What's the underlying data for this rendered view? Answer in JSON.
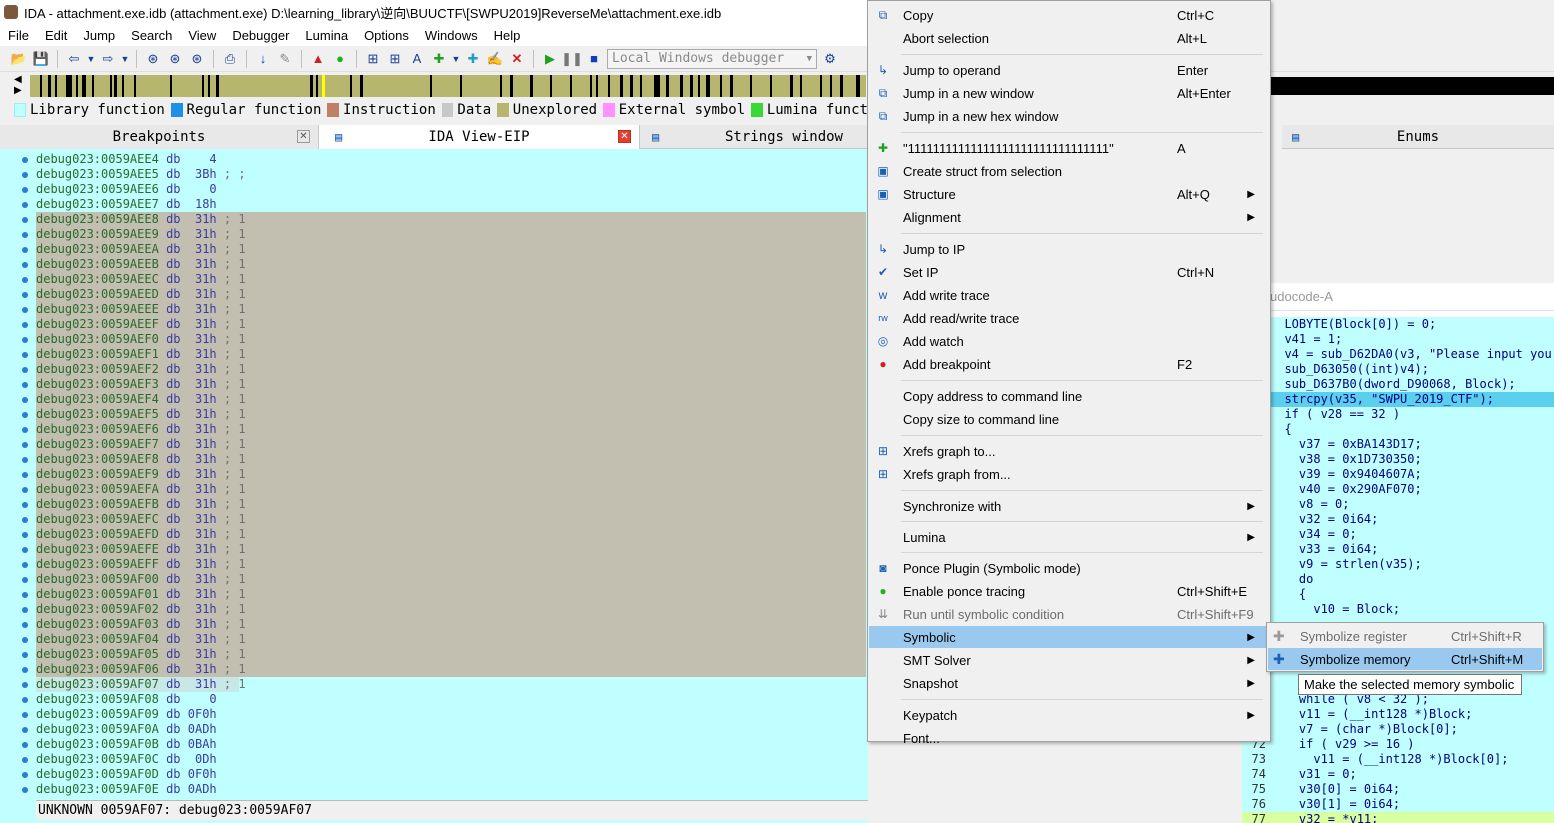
{
  "window": {
    "title": "IDA - attachment.exe.idb (attachment.exe) D:\\learning_library\\逆向\\BUUCTF\\[SWPU2019]ReverseMe\\attachment.exe.idb"
  },
  "menu": [
    "File",
    "Edit",
    "Jump",
    "Search",
    "View",
    "Debugger",
    "Lumina",
    "Options",
    "Windows",
    "Help"
  ],
  "toolbar": {
    "debugger": "Local Windows debugger"
  },
  "legend": [
    {
      "label": "Library function",
      "color": "#c0ffff"
    },
    {
      "label": "Regular function",
      "color": "#1e90e8"
    },
    {
      "label": "Instruction",
      "color": "#c08068"
    },
    {
      "label": "Data",
      "color": "#c8c8c8"
    },
    {
      "label": "Unexplored",
      "color": "#b6b66e"
    },
    {
      "label": "External symbol",
      "color": "#ff90ff"
    },
    {
      "label": "Lumina funct",
      "color": "#38d838"
    }
  ],
  "tabs": {
    "breakpoints": "Breakpoints",
    "ida_view": "IDA View-EIP",
    "strings": "Strings window",
    "enums": "Enums"
  },
  "disasm": [
    {
      "addr": "debug023:0059AEE4",
      "op": "db",
      "val": "   4",
      "cm": ""
    },
    {
      "addr": "debug023:0059AEE5",
      "op": "db",
      "val": " 3Bh",
      "cm": " ; ;"
    },
    {
      "addr": "debug023:0059AEE6",
      "op": "db",
      "val": "   0",
      "cm": ""
    },
    {
      "addr": "debug023:0059AEE7",
      "op": "db",
      "val": " 18h",
      "cm": ""
    },
    {
      "addr": "debug023:0059AEE8",
      "op": "db",
      "val": " 31h",
      "cm": " ; 1",
      "sel": true
    },
    {
      "addr": "debug023:0059AEE9",
      "op": "db",
      "val": " 31h",
      "cm": " ; 1",
      "sel": true
    },
    {
      "addr": "debug023:0059AEEA",
      "op": "db",
      "val": " 31h",
      "cm": " ; 1",
      "sel": true
    },
    {
      "addr": "debug023:0059AEEB",
      "op": "db",
      "val": " 31h",
      "cm": " ; 1",
      "sel": true
    },
    {
      "addr": "debug023:0059AEEC",
      "op": "db",
      "val": " 31h",
      "cm": " ; 1",
      "sel": true
    },
    {
      "addr": "debug023:0059AEED",
      "op": "db",
      "val": " 31h",
      "cm": " ; 1",
      "sel": true
    },
    {
      "addr": "debug023:0059AEEE",
      "op": "db",
      "val": " 31h",
      "cm": " ; 1",
      "sel": true
    },
    {
      "addr": "debug023:0059AEEF",
      "op": "db",
      "val": " 31h",
      "cm": " ; 1",
      "sel": true
    },
    {
      "addr": "debug023:0059AEF0",
      "op": "db",
      "val": " 31h",
      "cm": " ; 1",
      "sel": true
    },
    {
      "addr": "debug023:0059AEF1",
      "op": "db",
      "val": " 31h",
      "cm": " ; 1",
      "sel": true
    },
    {
      "addr": "debug023:0059AEF2",
      "op": "db",
      "val": " 31h",
      "cm": " ; 1",
      "sel": true
    },
    {
      "addr": "debug023:0059AEF3",
      "op": "db",
      "val": " 31h",
      "cm": " ; 1",
      "sel": true
    },
    {
      "addr": "debug023:0059AEF4",
      "op": "db",
      "val": " 31h",
      "cm": " ; 1",
      "sel": true
    },
    {
      "addr": "debug023:0059AEF5",
      "op": "db",
      "val": " 31h",
      "cm": " ; 1",
      "sel": true
    },
    {
      "addr": "debug023:0059AEF6",
      "op": "db",
      "val": " 31h",
      "cm": " ; 1",
      "sel": true
    },
    {
      "addr": "debug023:0059AEF7",
      "op": "db",
      "val": " 31h",
      "cm": " ; 1",
      "sel": true
    },
    {
      "addr": "debug023:0059AEF8",
      "op": "db",
      "val": " 31h",
      "cm": " ; 1",
      "sel": true
    },
    {
      "addr": "debug023:0059AEF9",
      "op": "db",
      "val": " 31h",
      "cm": " ; 1",
      "sel": true
    },
    {
      "addr": "debug023:0059AEFA",
      "op": "db",
      "val": " 31h",
      "cm": " ; 1",
      "sel": true
    },
    {
      "addr": "debug023:0059AEFB",
      "op": "db",
      "val": " 31h",
      "cm": " ; 1",
      "sel": true
    },
    {
      "addr": "debug023:0059AEFC",
      "op": "db",
      "val": " 31h",
      "cm": " ; 1",
      "sel": true
    },
    {
      "addr": "debug023:0059AEFD",
      "op": "db",
      "val": " 31h",
      "cm": " ; 1",
      "sel": true
    },
    {
      "addr": "debug023:0059AEFE",
      "op": "db",
      "val": " 31h",
      "cm": " ; 1",
      "sel": true
    },
    {
      "addr": "debug023:0059AEFF",
      "op": "db",
      "val": " 31h",
      "cm": " ; 1",
      "sel": true
    },
    {
      "addr": "debug023:0059AF00",
      "op": "db",
      "val": " 31h",
      "cm": " ; 1",
      "sel": true
    },
    {
      "addr": "debug023:0059AF01",
      "op": "db",
      "val": " 31h",
      "cm": " ; 1",
      "sel": true
    },
    {
      "addr": "debug023:0059AF02",
      "op": "db",
      "val": " 31h",
      "cm": " ; 1",
      "sel": true
    },
    {
      "addr": "debug023:0059AF03",
      "op": "db",
      "val": " 31h",
      "cm": " ; 1",
      "sel": true
    },
    {
      "addr": "debug023:0059AF04",
      "op": "db",
      "val": " 31h",
      "cm": " ; 1",
      "sel": true
    },
    {
      "addr": "debug023:0059AF05",
      "op": "db",
      "val": " 31h",
      "cm": " ; 1",
      "sel": true
    },
    {
      "addr": "debug023:0059AF06",
      "op": "db",
      "val": " 31h",
      "cm": " ; 1",
      "sel": true
    },
    {
      "addr": "debug023:0059AF07",
      "op": "db",
      "val": " 31h",
      "cm": " ; 1",
      "sel": true
    },
    {
      "addr": "debug023:0059AF08",
      "op": "db",
      "val": "   0",
      "cm": ""
    },
    {
      "addr": "debug023:0059AF09",
      "op": "db",
      "val": "0F0h",
      "cm": ""
    },
    {
      "addr": "debug023:0059AF0A",
      "op": "db",
      "val": "0ADh",
      "cm": ""
    },
    {
      "addr": "debug023:0059AF0B",
      "op": "db",
      "val": "0BAh",
      "cm": ""
    },
    {
      "addr": "debug023:0059AF0C",
      "op": "db",
      "val": " 0Dh",
      "cm": ""
    },
    {
      "addr": "debug023:0059AF0D",
      "op": "db",
      "val": "0F0h",
      "cm": ""
    },
    {
      "addr": "debug023:0059AF0E",
      "op": "db",
      "val": "0ADh",
      "cm": ""
    }
  ],
  "status": "UNKNOWN 0059AF07: debug023:0059AF07",
  "pseudocode": {
    "title": "udocode-A",
    "lines": [
      {
        "n": "44",
        "t": "  LOBYTE(Block[0]) = 0;"
      },
      {
        "n": "45",
        "t": "  v41 = 1;"
      },
      {
        "n": "46",
        "t": "  v4 = sub_D62DA0(v3, \"Please input you"
      },
      {
        "n": "47",
        "t": "  sub_D63050((int)v4);"
      },
      {
        "n": "48",
        "t": "  sub_D637B0(dword_D90068, Block);"
      },
      {
        "n": "49",
        "t": "  strcpy(v35, \"SWPU_2019_CTF\");",
        "hl": 1
      },
      {
        "n": "50",
        "t": "  if ( v28 == 32 )"
      },
      {
        "n": "51",
        "t": "  {"
      },
      {
        "n": "52",
        "t": "    v37 = 0xBA143D17;"
      },
      {
        "n": "53",
        "t": "    v38 = 0x1D730350;"
      },
      {
        "n": "54",
        "t": "    v39 = 0x9404607A;"
      },
      {
        "n": "55",
        "t": "    v40 = 0x290AF070;"
      },
      {
        "n": "56",
        "t": "    v8 = 0;"
      },
      {
        "n": "57",
        "t": "    v32 = 0i64;"
      },
      {
        "n": "58",
        "t": "    v34 = 0;"
      },
      {
        "n": "59",
        "t": "    v33 = 0i64;"
      },
      {
        "n": "60",
        "t": "    v9 = strlen(v35);"
      },
      {
        "n": "61",
        "t": "    do"
      },
      {
        "n": "62",
        "t": "    {"
      },
      {
        "n": "63",
        "t": "      v10 = Block;"
      },
      {
        "n": "64",
        "t": ""
      },
      {
        "n": "65",
        "t": ""
      },
      {
        "n": "66",
        "t": ""
      },
      {
        "n": "67",
        "t": ""
      },
      {
        "n": "68",
        "t": ""
      },
      {
        "n": "69",
        "t": "    while ( v8 < 32 );"
      },
      {
        "n": "70",
        "t": "    v11 = (__int128 *)Block;"
      },
      {
        "n": "71",
        "t": "    v7 = (char *)Block[0];"
      },
      {
        "n": "72",
        "t": "    if ( v29 >= 16 )"
      },
      {
        "n": "73",
        "t": "      v11 = (__int128 *)Block[0];"
      },
      {
        "n": "74",
        "t": "    v31 = 0;"
      },
      {
        "n": "75",
        "t": "    v30[0] = 0i64;"
      },
      {
        "n": "76",
        "t": "    v30[1] = 0i64;"
      },
      {
        "n": "77",
        "t": "    v32 = *v11;",
        "hl": 2
      }
    ]
  },
  "context_menu": [
    {
      "icon": "copy-icon",
      "g": "⧉",
      "label": "Copy",
      "sc": "Ctrl+C"
    },
    {
      "icon": "",
      "label": "Abort selection",
      "sc": "Alt+L"
    },
    {
      "sep": 1
    },
    {
      "icon": "jump-icon",
      "g": "↳",
      "label": "Jump to operand",
      "sc": "Enter"
    },
    {
      "icon": "jump-window-icon",
      "g": "⧉",
      "label": "Jump in a new window",
      "sc": "Alt+Enter"
    },
    {
      "icon": "jump-hex-icon",
      "g": "⧉",
      "label": "Jump in a new hex window",
      "sc": ""
    },
    {
      "sep": 1
    },
    {
      "icon": "string-icon",
      "g": "✚",
      "label": "\"11111111111111111111111111111111\"",
      "sc": "A"
    },
    {
      "icon": "struct-icon",
      "g": "▣",
      "label": "Create struct from selection",
      "sc": ""
    },
    {
      "icon": "structure-icon",
      "g": "▣",
      "label": "Structure",
      "sc": "Alt+Q",
      "arrow": 1
    },
    {
      "icon": "",
      "label": "Alignment",
      "sc": "",
      "arrow": 1
    },
    {
      "sep": 1
    },
    {
      "icon": "jump-ip-icon",
      "g": "↳",
      "label": "Jump to IP",
      "sc": ""
    },
    {
      "icon": "set-ip-icon",
      "g": "✔",
      "label": "Set IP",
      "sc": "Ctrl+N"
    },
    {
      "icon": "write-trace-icon",
      "g": "w",
      "label": "Add write trace",
      "sc": ""
    },
    {
      "icon": "rw-trace-icon",
      "g": "rw",
      "label": "Add read/write trace",
      "sc": ""
    },
    {
      "icon": "watch-icon",
      "g": "◎",
      "label": "Add watch",
      "sc": ""
    },
    {
      "icon": "breakpoint-icon",
      "g": "●",
      "label": "Add breakpoint",
      "sc": "F2"
    },
    {
      "sep": 1
    },
    {
      "icon": "",
      "label": "Copy address to command line",
      "sc": ""
    },
    {
      "icon": "",
      "label": "Copy size to command line",
      "sc": ""
    },
    {
      "sep": 1
    },
    {
      "icon": "xrefs-to-icon",
      "g": "⊞",
      "label": "Xrefs graph to...",
      "sc": ""
    },
    {
      "icon": "xrefs-from-icon",
      "g": "⊞",
      "label": "Xrefs graph from...",
      "sc": ""
    },
    {
      "sep": 1
    },
    {
      "icon": "",
      "label": "Synchronize with",
      "sc": "",
      "arrow": 1
    },
    {
      "sep": 1
    },
    {
      "icon": "",
      "label": "Lumina",
      "sc": "",
      "arrow": 1
    },
    {
      "sep": 1
    },
    {
      "icon": "ponce-icon",
      "g": "◙",
      "label": "Ponce Plugin (Symbolic mode)",
      "sc": ""
    },
    {
      "icon": "ponce-tracing-icon",
      "g": "●",
      "label": "Enable ponce tracing",
      "sc": "Ctrl+Shift+E"
    },
    {
      "icon": "run-until-icon",
      "g": "⇊",
      "label": "Run until symbolic condition",
      "sc": "Ctrl+Shift+F9",
      "dis": 1
    },
    {
      "icon": "",
      "label": "Symbolic",
      "sc": "",
      "arrow": 1,
      "hi": 1
    },
    {
      "icon": "",
      "label": "SMT Solver",
      "sc": "",
      "arrow": 1
    },
    {
      "icon": "",
      "label": "Snapshot",
      "sc": "",
      "arrow": 1
    },
    {
      "sep": 1
    },
    {
      "icon": "",
      "label": "Keypatch",
      "sc": "",
      "arrow": 1
    },
    {
      "icon": "",
      "label": "Font...",
      "sc": ""
    }
  ],
  "submenu": [
    {
      "label": "Symbolize register",
      "sc": "Ctrl+Shift+R",
      "dis": 1
    },
    {
      "label": "Symbolize memory",
      "sc": "Ctrl+Shift+M",
      "hi": 1
    }
  ],
  "tooltip": "Make the selected memory symbolic"
}
